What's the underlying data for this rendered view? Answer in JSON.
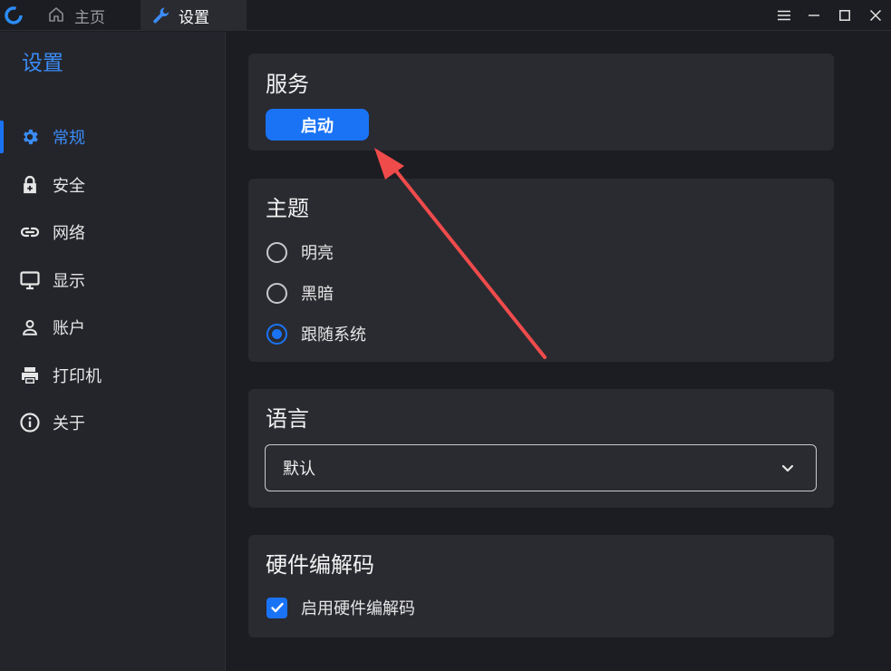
{
  "titlebar": {
    "tabs": [
      {
        "label": "主页",
        "icon": "home-icon"
      },
      {
        "label": "设置",
        "icon": "wrench-icon"
      }
    ]
  },
  "sidebar": {
    "title": "设置",
    "items": [
      {
        "label": "常规",
        "icon": "gear-icon",
        "active": true
      },
      {
        "label": "安全",
        "icon": "lock-icon"
      },
      {
        "label": "网络",
        "icon": "link-icon"
      },
      {
        "label": "显示",
        "icon": "monitor-icon"
      },
      {
        "label": "账户",
        "icon": "user-icon"
      },
      {
        "label": "打印机",
        "icon": "printer-icon"
      },
      {
        "label": "关于",
        "icon": "info-icon"
      }
    ]
  },
  "main": {
    "service": {
      "title": "服务",
      "start_label": "启动"
    },
    "theme": {
      "title": "主题",
      "options": [
        {
          "label": "明亮",
          "checked": false
        },
        {
          "label": "黑暗",
          "checked": false
        },
        {
          "label": "跟随系统",
          "checked": true
        }
      ]
    },
    "language": {
      "title": "语言",
      "selected": "默认"
    },
    "hardware": {
      "title": "硬件编解码",
      "checkbox_label": "启用硬件编解码",
      "checked": true
    }
  },
  "colors": {
    "accent": "#1a73f5",
    "sidebar_active": "#3b8cf6",
    "background": "#1c1d22",
    "card": "#2a2b31",
    "annotation_arrow": "#f04b4b"
  }
}
